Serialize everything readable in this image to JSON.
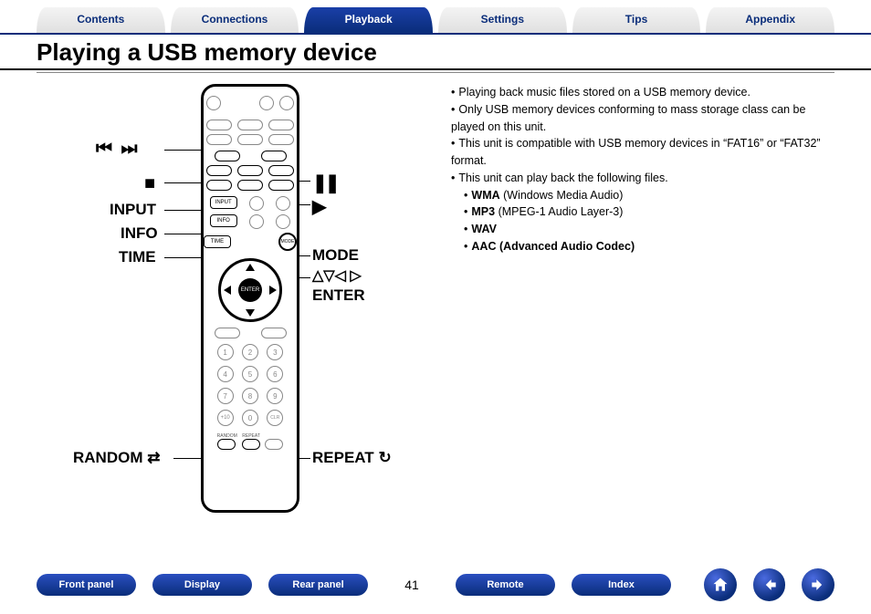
{
  "tabs": [
    {
      "label": "Contents",
      "active": false
    },
    {
      "label": "Connections",
      "active": false
    },
    {
      "label": "Playback",
      "active": true
    },
    {
      "label": "Settings",
      "active": false
    },
    {
      "label": "Tips",
      "active": false
    },
    {
      "label": "Appendix",
      "active": false
    }
  ],
  "title": "Playing a USB memory device",
  "bullets": [
    "Playing back music files stored on a USB memory device.",
    "Only USB memory devices conforming to mass storage class can be played on this unit.",
    "This unit is compatible with USB memory devices in “FAT16” or “FAT32” format.",
    "This unit can play back the following files."
  ],
  "file_types": [
    {
      "bold": "WMA",
      "rest": " (Windows Media Audio)"
    },
    {
      "bold": "MP3",
      "rest": " (MPEG-1 Audio Layer-3)"
    },
    {
      "bold": "WAV",
      "rest": ""
    },
    {
      "bold": "AAC (Advanced Audio Codec)",
      "rest": ""
    }
  ],
  "callouts": {
    "prev_next": "⏮ ⏭",
    "stop": "■",
    "pause": "❚❚",
    "play": "▶",
    "input": "INPUT",
    "info": "INFO",
    "time": "TIME",
    "mode": "MODE",
    "nav_arrows": "△▽◁ ▷",
    "enter": "ENTER",
    "random": "RANDOM",
    "random_icon": "⇄",
    "repeat": "REPEAT",
    "repeat_icon": "↻"
  },
  "remote_labels": {
    "enter_center": "ENTER",
    "input_btn": "INPUT",
    "info_btn": "INFO",
    "time_btn": "TIME",
    "mode_btn": "MODE",
    "random_small": "RANDOM",
    "repeat_small": "REPEAT"
  },
  "page_number": "41",
  "bottom_nav": {
    "front_panel": "Front panel",
    "display": "Display",
    "rear_panel": "Rear panel",
    "remote": "Remote",
    "index": "Index"
  }
}
